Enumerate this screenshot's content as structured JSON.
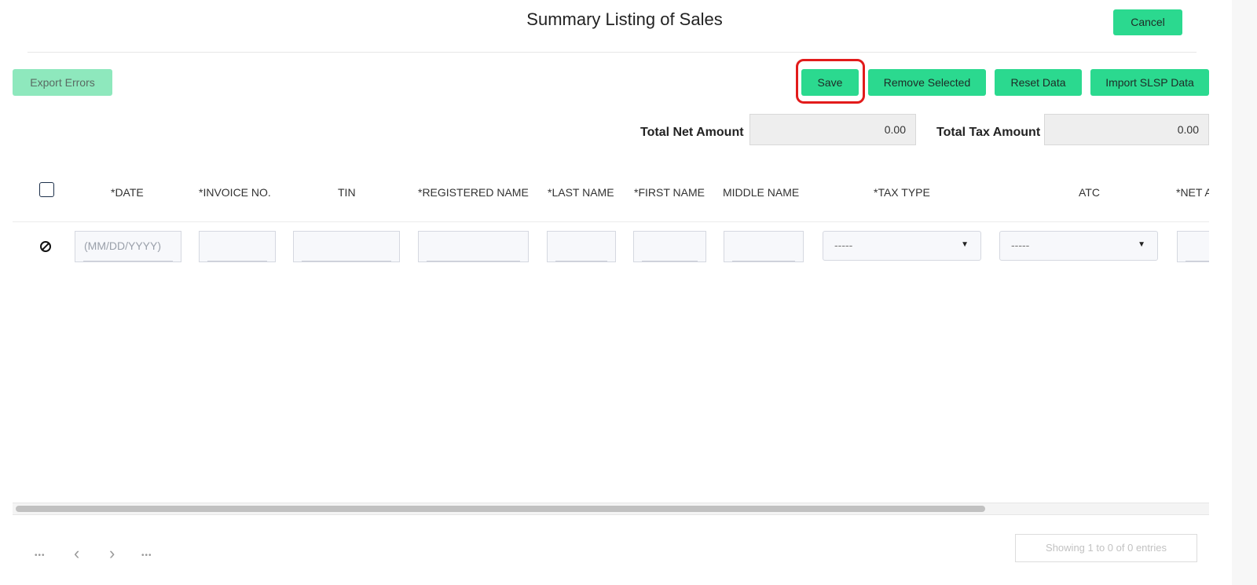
{
  "header": {
    "title": "Summary Listing of Sales",
    "cancel_label": "Cancel"
  },
  "toolbar": {
    "export_errors_label": "Export Errors",
    "save_label": "Save",
    "remove_selected_label": "Remove Selected",
    "reset_data_label": "Reset Data",
    "import_label": "Import SLSP Data"
  },
  "totals": {
    "net_label": "Total Net Amount",
    "net_value": "0.00",
    "tax_label": "Total Tax Amount",
    "tax_value": "0.00"
  },
  "table": {
    "columns": [
      "*DATE",
      "*INVOICE NO.",
      "TIN",
      "*REGISTERED NAME",
      "*LAST NAME",
      "*FIRST NAME",
      "MIDDLE NAME",
      "*TAX TYPE",
      "ATC",
      "*NET A"
    ],
    "row": {
      "date_placeholder": "(MM/DD/YYYY)",
      "tax_type_value": "-----",
      "atc_value": "-----"
    }
  },
  "pagination": {
    "first": "•••",
    "prev": "‹",
    "next": "›",
    "last": "•••",
    "entries_text": "Showing 1 to 0 of 0 entries"
  },
  "colors": {
    "accent": "#2bd98f",
    "accent_disabled": "#8ee8bd",
    "highlight": "#e21b1b"
  },
  "icons": {
    "row_status": "block-icon",
    "dropdown": "chevron-down-icon"
  }
}
